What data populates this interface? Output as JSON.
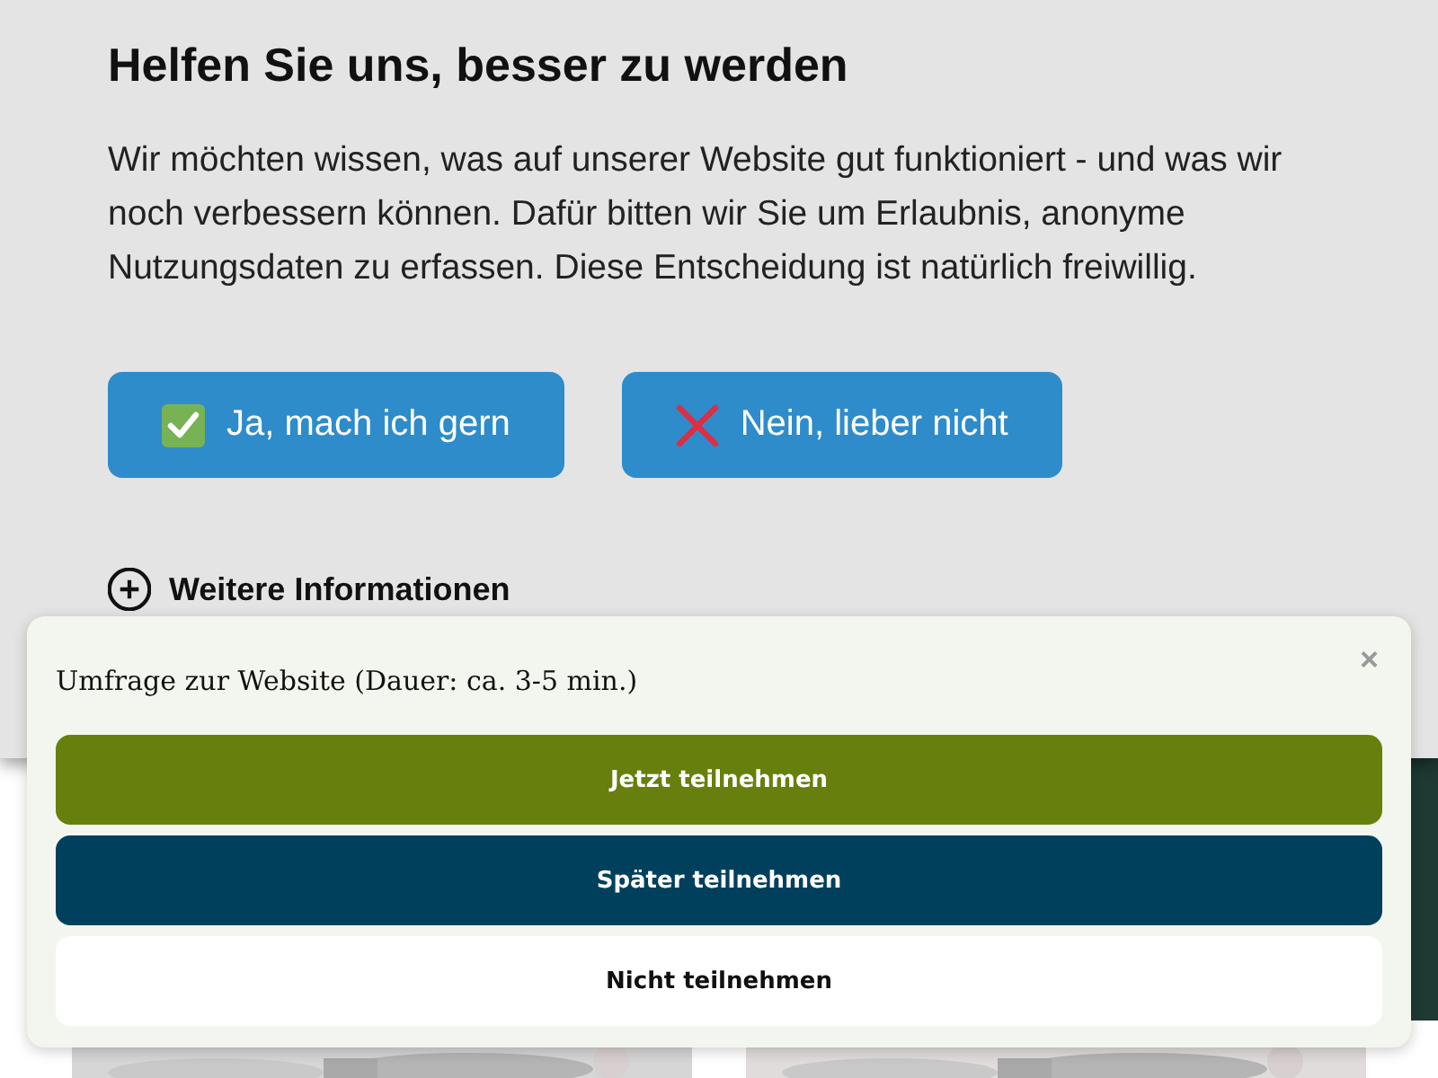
{
  "consent": {
    "title": "Helfen Sie uns, besser zu werden",
    "text": "Wir möchten wissen, was auf unserer Website gut funktioniert - und was wir noch verbessern können. Dafür bitten wir Sie um Erlaubnis, anonyme Nutzungsdaten zu erfassen. Diese Entscheidung ist natürlich freiwillig.",
    "buttons": [
      {
        "label": "Ja, mach ich gern",
        "kind": "accept"
      },
      {
        "label": "Nein, lieber nicht",
        "kind": "decline"
      }
    ],
    "more_info": "Weitere Informationen"
  },
  "survey": {
    "title": "Umfrage zur Website (Dauer: ca. 3-5 min.)",
    "close": "×",
    "buttons": [
      {
        "label": "Jetzt teilnehmen",
        "kind": "primary"
      },
      {
        "label": "Später teilnehmen",
        "kind": "secondary"
      },
      {
        "label": "Nicht teilnehmen",
        "kind": "plain"
      }
    ]
  }
}
